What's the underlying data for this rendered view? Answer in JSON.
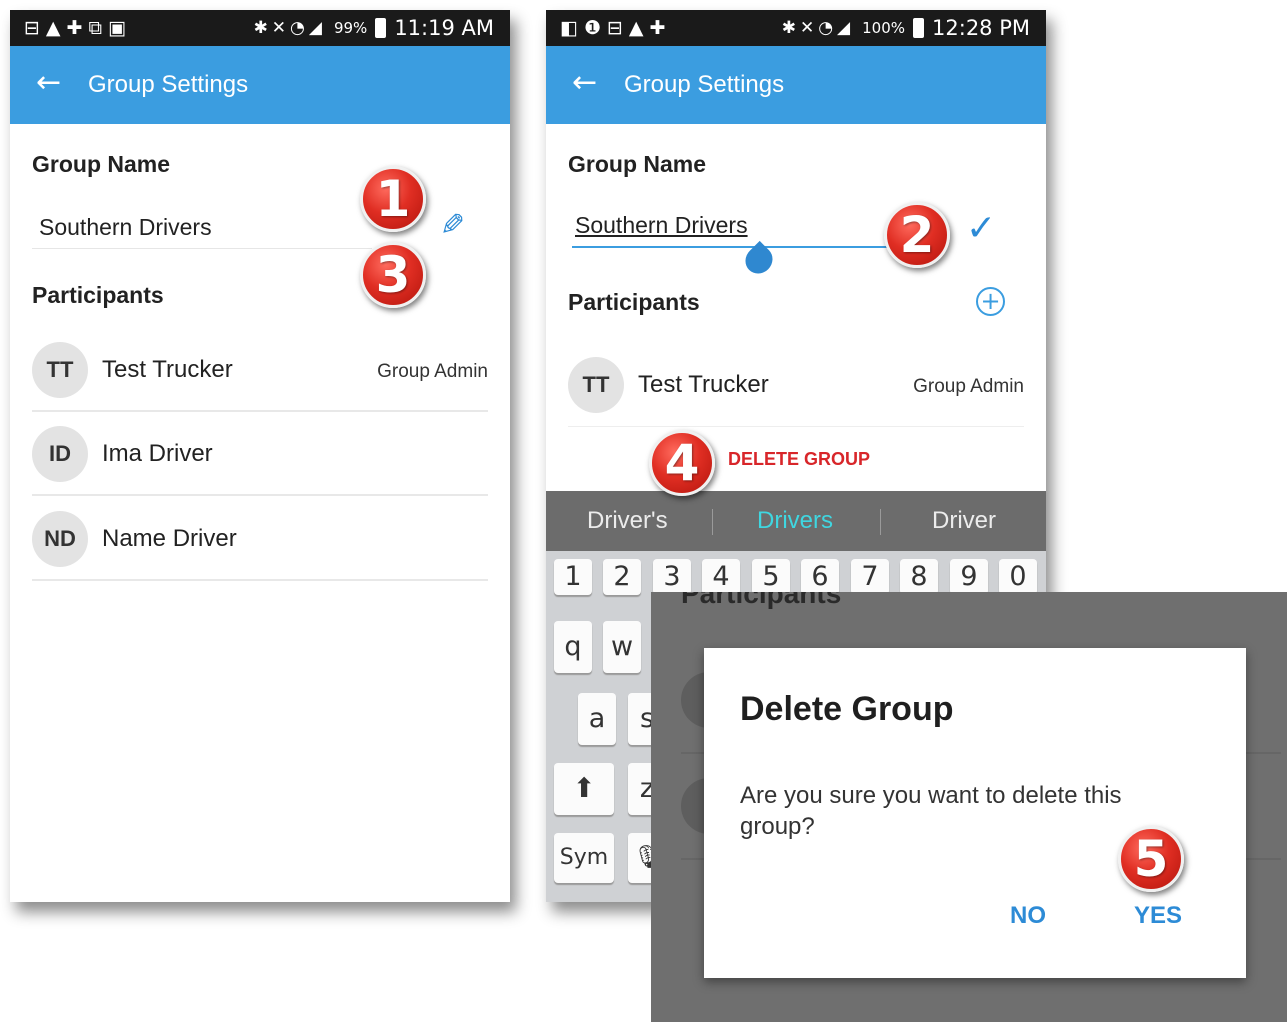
{
  "phone1": {
    "status_bar": {
      "battery": "99%",
      "time": "11:19 AM"
    },
    "app_bar": {
      "title": "Group Settings"
    },
    "group_name_label": "Group Name",
    "group_name_value": "Southern Drivers",
    "participants_label": "Participants",
    "participants": [
      {
        "initials": "TT",
        "name": "Test Trucker",
        "role": "Group Admin"
      },
      {
        "initials": "ID",
        "name": "Ima Driver",
        "role": ""
      },
      {
        "initials": "ND",
        "name": "Name Driver",
        "role": ""
      }
    ]
  },
  "phone2": {
    "status_bar": {
      "battery": "100%",
      "time": "12:28 PM"
    },
    "app_bar": {
      "title": "Group Settings"
    },
    "group_name_label": "Group Name",
    "group_name_input": "Southern Drivers",
    "participants_label": "Participants",
    "participants": [
      {
        "initials": "TT",
        "name": "Test Trucker",
        "role": "Group Admin"
      }
    ],
    "delete_group_label": "DELETE GROUP",
    "keyboard": {
      "suggestions": [
        "Driver's",
        "Drivers",
        "Driver"
      ],
      "number_row": [
        "1",
        "2",
        "3",
        "4",
        "5",
        "6",
        "7",
        "8",
        "9",
        "0"
      ],
      "visible_letters": [
        "q",
        "w",
        "a",
        "s",
        "z"
      ],
      "sym_label": "Sym",
      "suggestion_highlight_color": "#3fd6e0"
    }
  },
  "dialog": {
    "background_partial_text": "Participants",
    "title": "Delete Group",
    "message": "Are you sure you want to delete this group?",
    "no_label": "NO",
    "yes_label": "YES"
  },
  "callouts": [
    "1",
    "2",
    "3",
    "4",
    "5"
  ],
  "colors": {
    "app_bar": "#3b9de0",
    "accent": "#2d8bd6",
    "danger": "#d8262a",
    "callout": "#e02e23"
  }
}
